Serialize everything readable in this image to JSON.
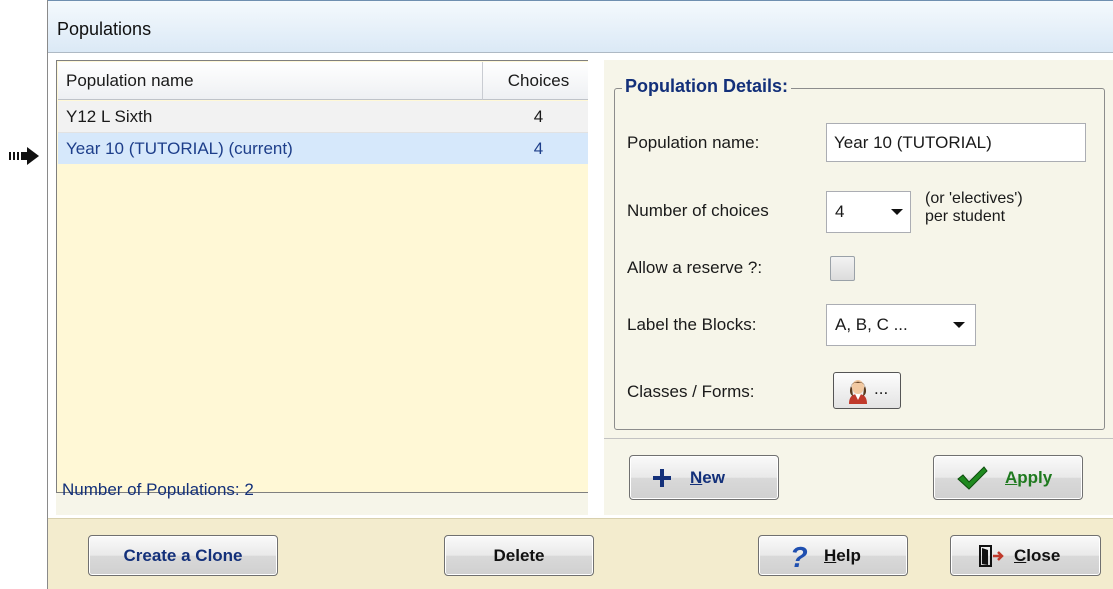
{
  "window": {
    "title": "Populations"
  },
  "list": {
    "columns": [
      "Population name",
      "Choices"
    ],
    "rows": [
      {
        "name": "Y12  L Sixth",
        "choices": "4",
        "selected": false
      },
      {
        "name": "Year 10  (TUTORIAL)  (current)",
        "choices": "4",
        "selected": true
      }
    ],
    "footer": "Number of Populations: 2"
  },
  "details": {
    "legend": "Population Details:",
    "name_label": "Population name:",
    "name_value": "Year 10  (TUTORIAL)",
    "choices_label": "Number of choices",
    "choices_value": "4",
    "choices_note_1": "(or 'electives')",
    "choices_note_2": "per student",
    "reserve_label": "Allow a reserve ?:",
    "reserve_checked": false,
    "blocks_label": "Label the Blocks:",
    "blocks_value": "A, B, C ...",
    "classes_label": "Classes / Forms:",
    "classes_button": "..."
  },
  "buttons": {
    "new_underlined": "N",
    "new_rest": "ew",
    "apply_underlined": "A",
    "apply_rest": "pply",
    "clone": "Create a Clone",
    "delete": "Delete",
    "help_underlined": "H",
    "help_rest": "elp",
    "close_underlined": "C",
    "close_rest": "lose"
  },
  "icons": {
    "pointer": "pointer-arrow-icon",
    "new": "plus-icon",
    "apply": "checkmark-icon",
    "help": "question-icon",
    "close": "door-exit-icon",
    "classes": "person-icon"
  },
  "colors": {
    "accent_text": "#13307a",
    "selected_row": "#d6e8fb",
    "panel_bg": "#f6f5e9",
    "bottom_bar": "#f3ecce"
  }
}
